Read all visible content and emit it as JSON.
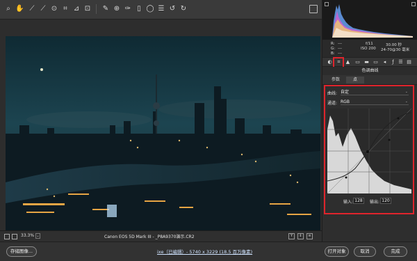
{
  "toolbar": {
    "tools": [
      "zoom-icon",
      "hand-icon",
      "white-balance-icon",
      "color-sampler-icon",
      "crop-icon",
      "straighten-icon",
      "transform-icon",
      "spot-removal-icon",
      "red-eye-icon",
      "adjustment-brush-icon",
      "graduated-filter-icon",
      "radial-filter-icon",
      "preferences-icon",
      "rotate-ccw-icon",
      "rotate-cw-icon"
    ]
  },
  "status": {
    "zoom": "33.3%",
    "zoom_caret": "⌄",
    "filename": "Canon EOS 5D Mark III - _P8A9370演示.CR2",
    "right_buttons": [
      "Y",
      "⇕",
      "≡"
    ]
  },
  "bottom": {
    "save_label": "存储图像...",
    "workflow_prefix": "",
    "workflow_link": "ixe（已编辑）- 5740 x 3229 (18.5 百万像素)",
    "open_label": "打开对象",
    "cancel_label": "取消",
    "done_label": "完成"
  },
  "info": {
    "r_label": "R:",
    "r_val": "---",
    "g_label": "G:",
    "g_val": "---",
    "b_label": "B:",
    "b_val": "---",
    "aperture": "f/11",
    "shutter": "30.00 秒",
    "iso": "ISO 200",
    "lens": "24-70@30 毫米"
  },
  "panel": {
    "title": "色调曲线",
    "subtabs": [
      "参数",
      "点"
    ],
    "curve_label": "曲线:",
    "curve_value": "自定",
    "channel_label": "通道:",
    "channel_value": "RGB",
    "input_label": "输入:",
    "input_value": "128",
    "output_label": "输出:",
    "output_value": "120"
  },
  "colors": {
    "highlight": "#e0242c",
    "accent_link": "#cfe3ff"
  }
}
